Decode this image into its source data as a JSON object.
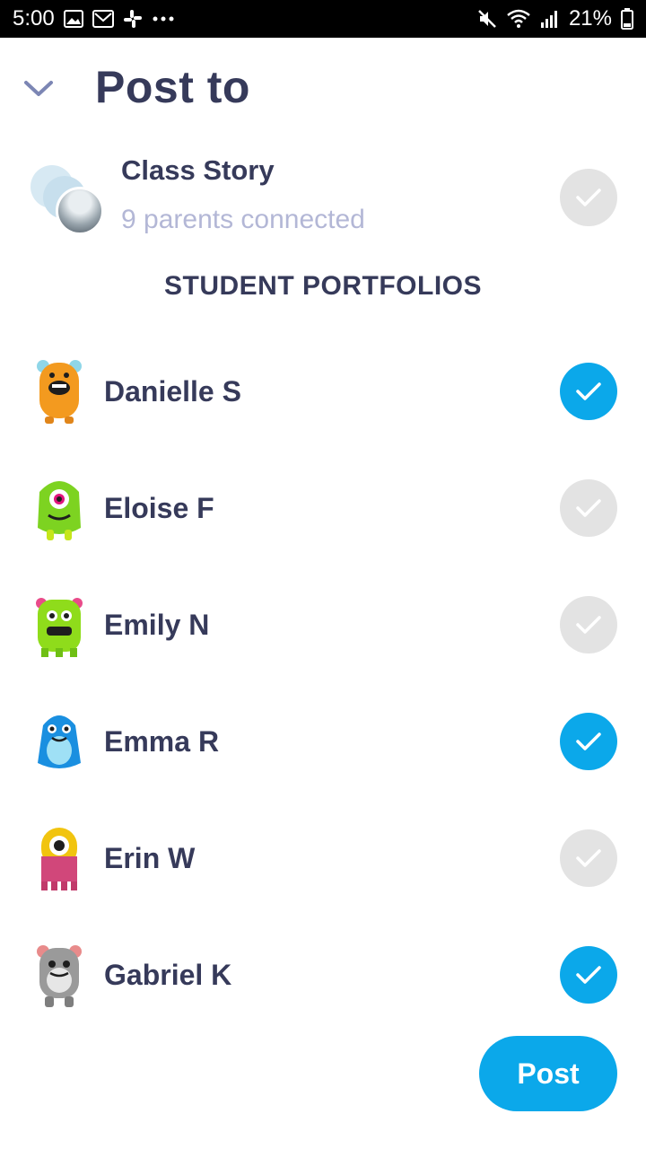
{
  "status_bar": {
    "time": "5:00",
    "battery": "21%",
    "icons_left": [
      "image-icon",
      "gmail-icon",
      "slack-icon",
      "more-icon"
    ],
    "icons_right": [
      "mute-icon",
      "wifi-icon",
      "signal-icon",
      "battery-icon"
    ]
  },
  "header": {
    "title": "Post to",
    "back_icon": "chevron-down-icon"
  },
  "class_story": {
    "title": "Class Story",
    "subtitle": "9 parents connected",
    "selected": false
  },
  "section_heading": "STUDENT PORTFOLIOS",
  "students": [
    {
      "name": "Danielle S",
      "selected": true,
      "avatar_color": "#f39a1f",
      "avatar_icon": "orange-monster-icon"
    },
    {
      "name": "Eloise F",
      "selected": false,
      "avatar_color": "#7dd321",
      "avatar_icon": "green-monster-icon"
    },
    {
      "name": "Emily N",
      "selected": false,
      "avatar_color": "#8fdc1b",
      "avatar_icon": "lime-monster-icon"
    },
    {
      "name": "Emma R",
      "selected": true,
      "avatar_color": "#1a8fe0",
      "avatar_icon": "blue-monster-icon"
    },
    {
      "name": "Erin W",
      "selected": false,
      "avatar_color": "#f1c40f",
      "avatar_icon": "yellow-monster-icon"
    },
    {
      "name": "Gabriel K",
      "selected": true,
      "avatar_color": "#9a9a9a",
      "avatar_icon": "gray-monster-icon"
    }
  ],
  "post_button": {
    "label": "Post"
  },
  "colors": {
    "accent": "#0ba8ea",
    "text_primary": "#363a5a",
    "text_secondary": "#b3b7d6",
    "unchecked": "#e3e3e3"
  }
}
